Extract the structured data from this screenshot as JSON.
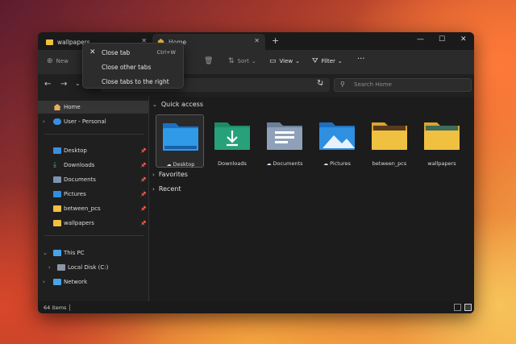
{
  "tabs": [
    {
      "label": "wallpapers"
    },
    {
      "label": "Home"
    }
  ],
  "toolbar": {
    "new_label": "New",
    "sort_label": "Sort",
    "view_label": "View",
    "filter_label": "Filter"
  },
  "search": {
    "placeholder": "Search Home"
  },
  "sidebar": {
    "items": [
      {
        "label": "Home"
      },
      {
        "label": "User - Personal"
      },
      {
        "label": "Desktop"
      },
      {
        "label": "Downloads"
      },
      {
        "label": "Documents"
      },
      {
        "label": "Pictures"
      },
      {
        "label": "between_pcs"
      },
      {
        "label": "wallpapers"
      },
      {
        "label": "This PC"
      },
      {
        "label": "Local Disk (C:)"
      },
      {
        "label": "Network"
      }
    ]
  },
  "content": {
    "sections": {
      "quick_access": "Quick access",
      "favorites": "Favorites",
      "recent": "Recent"
    },
    "tiles": [
      {
        "label": "Desktop"
      },
      {
        "label": "Downloads"
      },
      {
        "label": "Documents"
      },
      {
        "label": "Pictures"
      },
      {
        "label": "between_pcs"
      },
      {
        "label": "wallpapers"
      }
    ]
  },
  "status": {
    "item_count": "64 items"
  },
  "context_menu": {
    "items": [
      {
        "label": "Close tab",
        "shortcut": "Ctrl+W"
      },
      {
        "label": "Close other tabs"
      },
      {
        "label": "Close tabs to the right"
      }
    ]
  },
  "colors": {
    "accent": "#2f8fe0",
    "folder_yellow": "#f0c040",
    "folder_green": "#27a17a",
    "window_bg": "#1c1c1c"
  },
  "icons": [
    "folder-icon",
    "home-icon",
    "close-icon",
    "plus-icon",
    "minimize-icon",
    "maximize-icon",
    "back-arrow-icon",
    "forward-arrow-icon",
    "refresh-icon",
    "search-icon",
    "pin-icon",
    "cloud-icon",
    "pc-icon",
    "disk-icon",
    "network-icon",
    "more-icon",
    "sort-icon",
    "view-icon",
    "filter-icon",
    "trash-icon"
  ]
}
